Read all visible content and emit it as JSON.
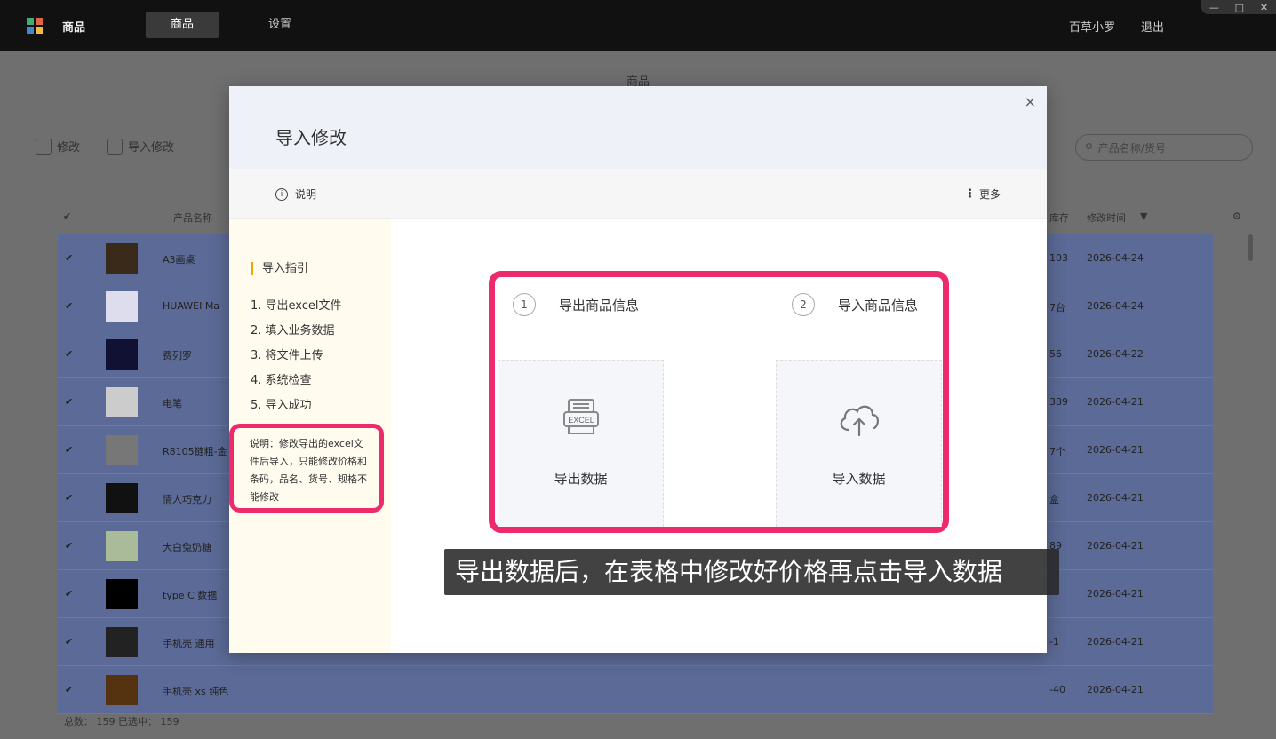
{
  "app": {
    "name": "商品",
    "nav": [
      "商品",
      "设置"
    ],
    "user": "百草小罗",
    "logout": "退出",
    "window_controls": [
      "—",
      "□",
      "✕"
    ]
  },
  "page": {
    "title": "商品",
    "edit_btn": "修改",
    "import_edit_btn": "导入修改",
    "search_placeholder": "产品名称/货号",
    "columns": {
      "name": "产品名称",
      "date": "修改时间",
      "stock": "库存"
    },
    "rows": [
      {
        "name": "A3画桌",
        "num": "103",
        "date": "2026-04-24"
      },
      {
        "name": "HUAWEI Ma",
        "num": "7台",
        "date": "2026-04-24"
      },
      {
        "name": "费列罗",
        "num": "56",
        "date": "2026-04-22"
      },
      {
        "name": "电笔",
        "num": "389",
        "date": "2026-04-21"
      },
      {
        "name": "R8105链粗-金",
        "num": "7个",
        "date": "2026-04-21"
      },
      {
        "name": "情人巧克力",
        "num": "盒",
        "date": "2026-04-21"
      },
      {
        "name": "大白兔奶糖",
        "num": "89",
        "date": "2026-04-21"
      },
      {
        "name": "type C 数据",
        "num": "",
        "date": "2026-04-21"
      },
      {
        "name": "手机壳 通用",
        "num": "-1",
        "date": "2026-04-21"
      },
      {
        "name": "手机壳 xs 纯色",
        "num": "-40",
        "date": "2026-04-21"
      }
    ],
    "footer": "总数：   159     已选中：   159"
  },
  "modal": {
    "title": "导入修改",
    "close": "×",
    "info_label": "说明",
    "more_label": "更多",
    "guide_title": "导入指引",
    "steps": [
      "1. 导出excel文件",
      "2. 填入业务数据",
      "3. 将文件上传",
      "4. 系统检查",
      "5. 导入成功"
    ],
    "note": "说明：修改导出的excel文件后导入，只能修改价格和条码，品名、货号、规格不能修改",
    "step1_num": "1",
    "step1_label": "导出商品信息",
    "step2_num": "2",
    "step2_label": "导入商品信息",
    "export_label": "导出数据",
    "import_label": "导入数据",
    "excel_text": "EXCEL"
  },
  "caption": "导出数据后，在表格中修改好价格再点击导入数据"
}
